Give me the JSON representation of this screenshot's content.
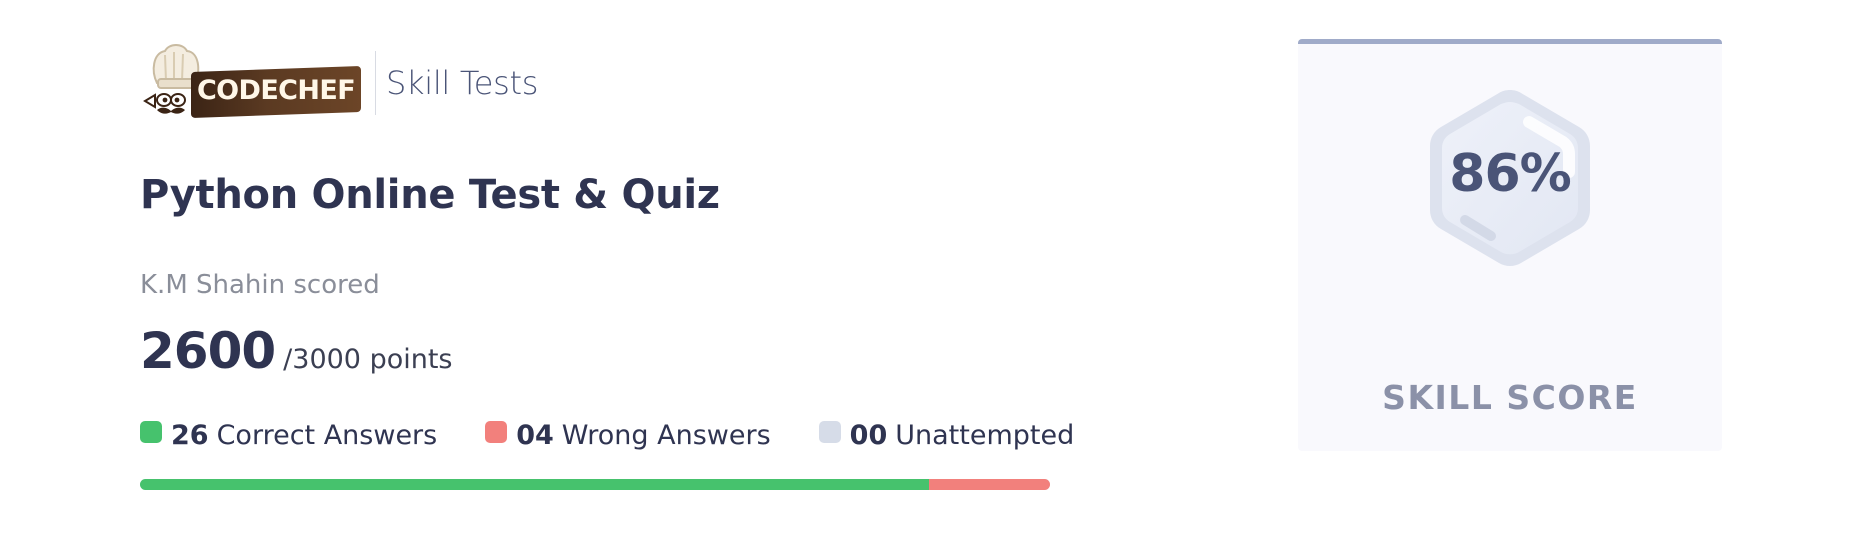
{
  "brand": {
    "logo_text": "CODECHEF",
    "logo_icon": "chef-hat-logo-icon",
    "subtitle": "Skill Tests"
  },
  "test": {
    "title": "Python Online Test & Quiz",
    "scored_by": "K.M Shahin scored",
    "score": "2600",
    "score_total": "/3000 points"
  },
  "legend": [
    {
      "count": "26",
      "label": "Correct Answers",
      "color": "#46c26d"
    },
    {
      "count": "04",
      "label": "Wrong Answers",
      "color": "#f2807c"
    },
    {
      "count": "00",
      "label": "Unattempted",
      "color": "#d6dce8"
    }
  ],
  "progress": [
    {
      "status": "correct",
      "fraction": 0.8667,
      "color": "#46c26d"
    },
    {
      "status": "wrong",
      "fraction": 0.1333,
      "color": "#f2807c"
    },
    {
      "status": "unattempted",
      "fraction": 0.0,
      "color": "#d6dce8"
    }
  ],
  "skill_card": {
    "percent": "86%",
    "label": "SKILL SCORE",
    "badge_icon": "hexagon-badge-icon",
    "accent": "#a0abc9"
  }
}
